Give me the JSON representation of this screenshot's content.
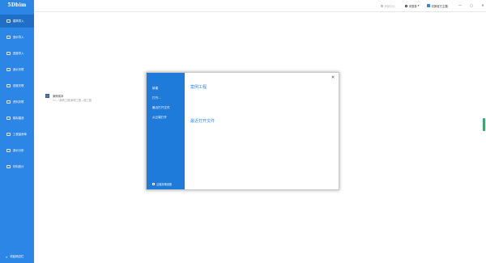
{
  "app": {
    "logo": "5Dbim"
  },
  "sidebar": {
    "items": [
      {
        "label": "建筑导入",
        "active": true
      },
      {
        "label": "造价导入"
      },
      {
        "label": "进度导入"
      },
      {
        "label": "造价关联"
      },
      {
        "label": "进度关联"
      },
      {
        "label": "资料关联"
      },
      {
        "label": "模拟建造"
      },
      {
        "label": "工程量清单"
      },
      {
        "label": "造价分析"
      },
      {
        "label": "材料统计"
      }
    ],
    "footer_label": "收起侧边栏"
  },
  "topbar": {
    "message_label": "消息中心",
    "user_label": "未登录",
    "user_caret": "▾",
    "vip_label": "切换官方主题",
    "minimize": "—",
    "maximize": "◻",
    "close": "✕"
  },
  "dialog": {
    "menu": [
      "新建",
      "打开...",
      "最近打开文件",
      "从云端打开"
    ],
    "cloud_settings": "云端存储设置",
    "close": "✕",
    "sample_section_title": "案例工程",
    "sample_name": "案例成本",
    "sample_path": "C:\\...\\案例工程\\案例工程—施工图",
    "recent_section_title": "最近打开文件"
  },
  "colors": {
    "sidebar": "#2b86e6",
    "dialog_sidebar": "#1f7bd9",
    "accent": "#2b86e6"
  }
}
